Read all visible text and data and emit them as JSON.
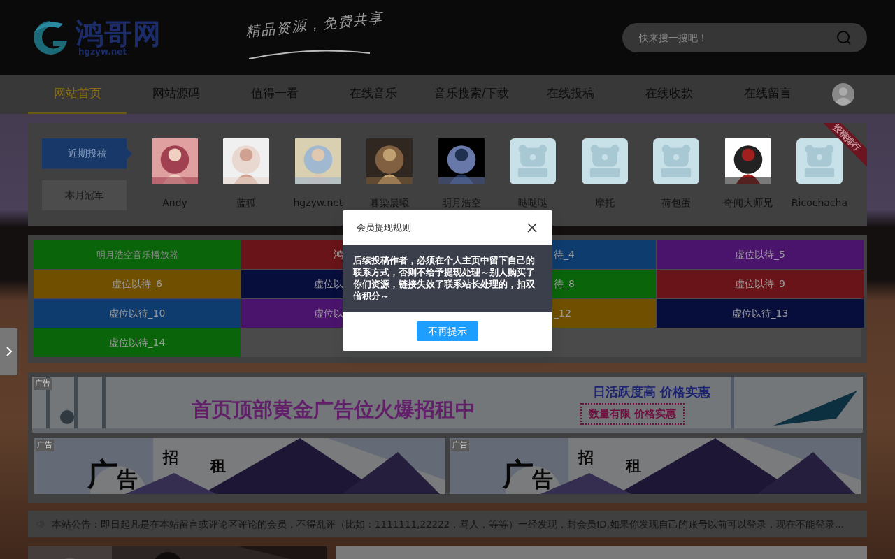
{
  "header": {
    "logo": {
      "name": "鸿哥网",
      "domain": "hgzyw.net"
    },
    "slogan": "精品资源，免费共享",
    "search": {
      "placeholder": "快来搜一搜吧！"
    }
  },
  "nav": [
    {
      "label": "网站首页",
      "selected": true
    },
    {
      "label": "网站源码",
      "selected": false
    },
    {
      "label": "值得一看",
      "selected": false
    },
    {
      "label": "在线音乐",
      "selected": false
    },
    {
      "label": "音乐搜索/下载",
      "selected": false
    },
    {
      "label": "在线投稿",
      "selected": false
    },
    {
      "label": "在线收款",
      "selected": false
    },
    {
      "label": "在线留言",
      "selected": false
    }
  ],
  "recent": {
    "ribbon": "投稿排行",
    "tabs": [
      {
        "label": "近期投稿",
        "selected": true
      },
      {
        "label": "本月冠军",
        "selected": false
      }
    ],
    "users": [
      {
        "name": "Andy"
      },
      {
        "name": "蓝狐"
      },
      {
        "name": "hgzyw.net"
      },
      {
        "name": "暮染晨曦"
      },
      {
        "name": "明月浩空"
      },
      {
        "name": "哒哒哒",
        "kind": "placeholder"
      },
      {
        "name": "摩托",
        "kind": "placeholder"
      },
      {
        "name": "荷包蛋",
        "kind": "placeholder"
      },
      {
        "name": "奇闻大师兄"
      },
      {
        "name": "Ricochacha",
        "kind": "placeholder"
      }
    ]
  },
  "tiles": [
    {
      "text": "明月浩空音乐播放器",
      "color": "#0a640a",
      "kind": "whole"
    },
    {
      "text": "鸿",
      "color": "#681418",
      "kind": "headpart"
    },
    {
      "text": "待_4",
      "color": "#0e3c6e",
      "kind": "tailpart"
    },
    {
      "text": "虚位以待_5",
      "color": "#4b146c",
      "kind": "whole"
    },
    {
      "text": "虚位以待_6",
      "color": "#705000",
      "kind": "whole"
    },
    {
      "text": "虚位以",
      "color": "#080e3c",
      "kind": "headpart"
    },
    {
      "text": "待_8",
      "color": "#0a640a",
      "kind": "tailpart"
    },
    {
      "text": "虚位以待_9",
      "color": "#681418",
      "kind": "whole"
    },
    {
      "text": "虚位以待_10",
      "color": "#0e3c6e",
      "kind": "whole"
    },
    {
      "text": "虚位以",
      "color": "#4b146c",
      "kind": "headpart"
    },
    {
      "text": "_12",
      "color": "#705000",
      "kind": "tailpart"
    },
    {
      "text": "虚位以待_13",
      "color": "#080e3c",
      "kind": "whole"
    },
    {
      "text": "虚位以待_14",
      "color": "#0a640a",
      "kind": "whole"
    }
  ],
  "ads": {
    "top": {
      "tag": "广告",
      "headline": "首页顶部黄金广告位火爆招租中",
      "sub1": "日活跃度高  价格实惠",
      "sub2": "数量有限  价格实惠"
    },
    "banners": [
      {
        "tag": "广告",
        "chars": [
          "广",
          "告",
          "招",
          "租"
        ]
      },
      {
        "tag": "广告",
        "chars": [
          "广",
          "告",
          "招",
          "租"
        ]
      }
    ]
  },
  "notice": "本站公告：即日起凡是在本站留言或评论区评论的会员，不得乱评（比如：1111111,22222，骂人，等等）一经发现，封会员ID,如果你发现自己的账号以前可以登录，现在不能登录...",
  "modal": {
    "title": "会员提现规则",
    "body": "后续投稿作者，必须在个人主页中留下自己的联系方式，否则不给予提现处理～别人购买了你们资源，链接失效了联系站长处理的，扣双倍积分～",
    "button": "不再提示"
  }
}
